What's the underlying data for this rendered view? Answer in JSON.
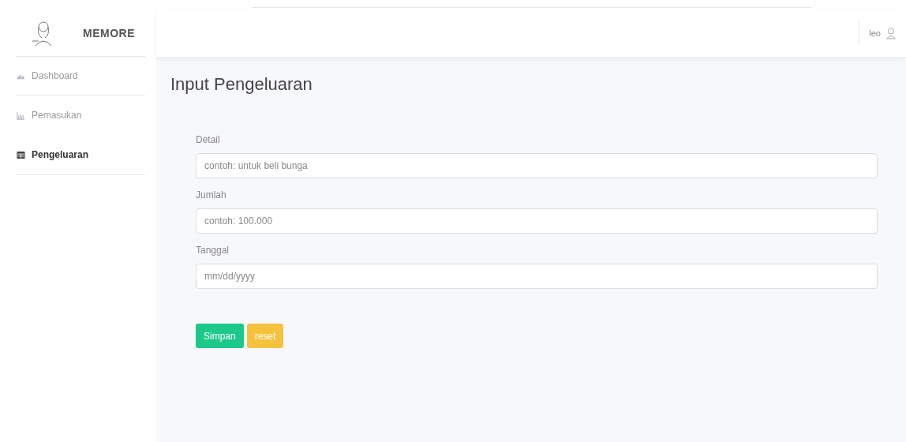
{
  "header": {
    "brand": "MEMORE",
    "user": "leo"
  },
  "sidebar": {
    "items": [
      {
        "label": "Dashboard",
        "kind": "gauge",
        "selected": false
      },
      {
        "label": "Pemasukan",
        "kind": "chart",
        "selected": false
      },
      {
        "label": "Pengeluaran",
        "kind": "table",
        "selected": true
      }
    ]
  },
  "page": {
    "title": "Input Pengeluaran"
  },
  "form": {
    "fields": [
      {
        "label": "Detail",
        "placeholder": "contoh: untuk beli bunga"
      },
      {
        "label": "Jumlah",
        "placeholder": "contoh: 100.000"
      },
      {
        "label": "Tanggal",
        "placeholder": "mm/dd/yyyy"
      }
    ],
    "buttons": [
      {
        "label": "Simpan",
        "kind": "primary"
      },
      {
        "label": "reset",
        "kind": "warning"
      }
    ]
  }
}
